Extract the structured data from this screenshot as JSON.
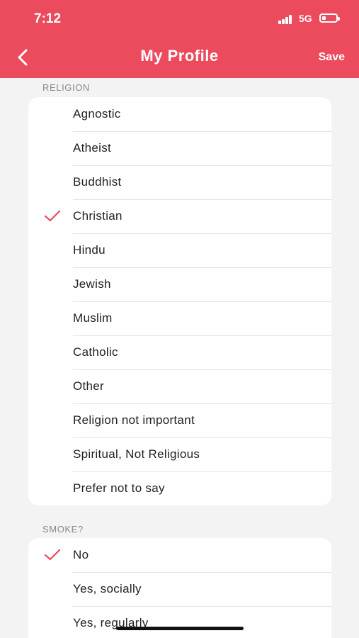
{
  "status_bar": {
    "time": "7:12",
    "network": "5G"
  },
  "header": {
    "title": "My Profile",
    "save_label": "Save",
    "back_icon": "chevron-left-icon"
  },
  "colors": {
    "accent": "#ec4a5d",
    "background": "#f3f3f3",
    "card": "#ffffff"
  },
  "religion": {
    "label": "RELIGION",
    "selected": "Christian",
    "options": [
      "Agnostic",
      "Atheist",
      "Buddhist",
      "Christian",
      "Hindu",
      "Jewish",
      "Muslim",
      "Catholic",
      "Other",
      "Religion not important",
      "Spiritual, Not Religious",
      "Prefer not to say"
    ]
  },
  "smoke": {
    "label": "SMOKE?",
    "selected": "No",
    "options": [
      "No",
      "Yes, socially",
      "Yes, regularly"
    ]
  }
}
